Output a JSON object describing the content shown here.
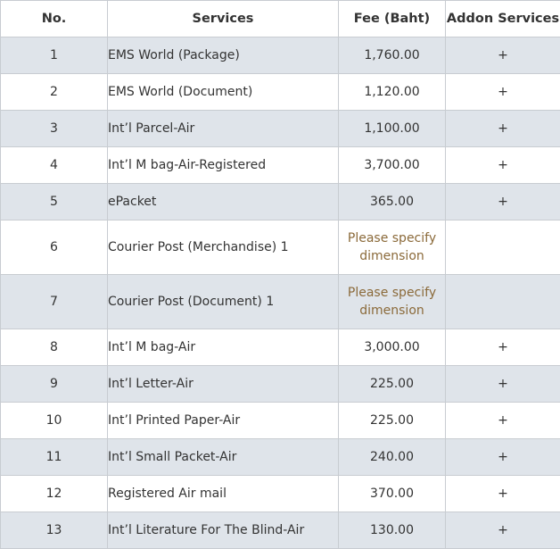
{
  "table": {
    "headers": {
      "no": "No.",
      "services": "Services",
      "fee": "Fee (Baht)",
      "addon": "Addon Services"
    },
    "rows": [
      {
        "no": "1",
        "service": "EMS World (Package)",
        "fee": "1,760.00",
        "addon": "+"
      },
      {
        "no": "2",
        "service": "EMS World (Document)",
        "fee": "1,120.00",
        "addon": "+"
      },
      {
        "no": "3",
        "service": "Int’l Parcel-Air",
        "fee": "1,100.00",
        "addon": "+"
      },
      {
        "no": "4",
        "service": "Int’l M bag-Air-Registered",
        "fee": "3,700.00",
        "addon": "+"
      },
      {
        "no": "5",
        "service": "ePacket",
        "fee": "365.00",
        "addon": "+"
      },
      {
        "no": "6",
        "service": "Courier Post (Merchandise) 1",
        "fee_line1": "Please specify",
        "fee_line2": "dimension",
        "addon": ""
      },
      {
        "no": "7",
        "service": "Courier Post (Document) 1",
        "fee_line1": "Please specify",
        "fee_line2": "dimension",
        "addon": ""
      },
      {
        "no": "8",
        "service": "Int’l M bag-Air",
        "fee": "3,000.00",
        "addon": "+"
      },
      {
        "no": "9",
        "service": "Int’l Letter-Air",
        "fee": "225.00",
        "addon": "+"
      },
      {
        "no": "10",
        "service": "Int’l Printed Paper-Air",
        "fee": "225.00",
        "addon": "+"
      },
      {
        "no": "11",
        "service": "Int’l Small Packet-Air",
        "fee": "240.00",
        "addon": "+"
      },
      {
        "no": "12",
        "service": "Registered Air mail",
        "fee": "370.00",
        "addon": "+"
      },
      {
        "no": "13",
        "service": "Int’l Literature For The Blind-Air",
        "fee": "130.00",
        "addon": "+"
      }
    ]
  },
  "colors": {
    "row_shade": "#dfe4ea",
    "row_plain": "#ffffff",
    "border": "#c8ccd1",
    "note_text": "#8b6a3a"
  }
}
